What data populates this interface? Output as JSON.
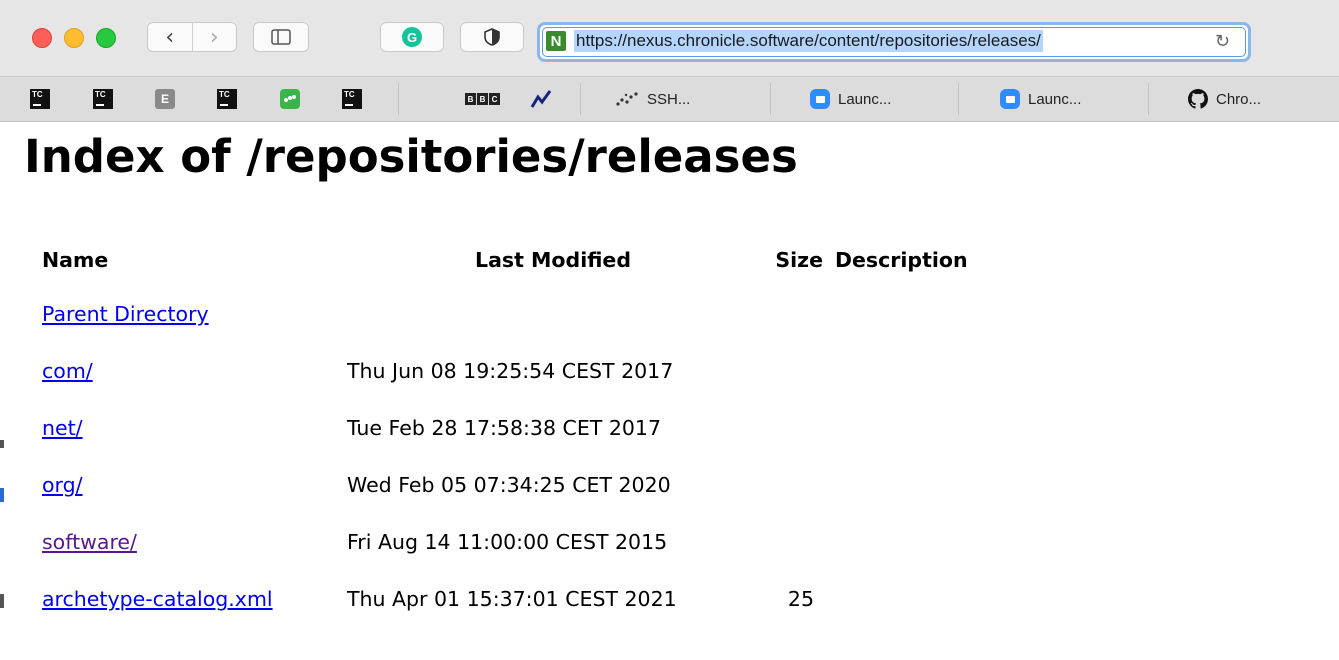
{
  "browser": {
    "url": "https://nexus.chronicle.software/content/repositories/releases/",
    "favicon_letter": "N",
    "nav_back_glyph": "‹",
    "nav_forward_glyph": "›",
    "grammarly_letter": "G"
  },
  "bookmarks": [
    {
      "icon": "tc-icon",
      "glyph": "TC",
      "label": ""
    },
    {
      "icon": "tc-icon",
      "glyph": "TC",
      "label": ""
    },
    {
      "icon": "e-icon",
      "glyph": "E",
      "label": ""
    },
    {
      "icon": "tc-icon",
      "glyph": "TC",
      "label": ""
    },
    {
      "icon": "green-app-icon",
      "glyph": "",
      "label": ""
    },
    {
      "icon": "tc-icon",
      "glyph": "TC",
      "label": ""
    },
    {
      "icon": "bbc-icon",
      "glyph": "BBC",
      "label": ""
    },
    {
      "icon": "chart-icon",
      "glyph": "",
      "label": ""
    },
    {
      "icon": "dots-icon",
      "glyph": "",
      "label": "SSH..."
    },
    {
      "icon": "zoom-icon",
      "glyph": "",
      "label": "Launc..."
    },
    {
      "icon": "zoom-icon",
      "glyph": "",
      "label": "Launc..."
    },
    {
      "icon": "github-icon",
      "glyph": "",
      "label": "Chro..."
    }
  ],
  "page": {
    "title": "Index of /repositories/releases",
    "columns": {
      "name": "Name",
      "last_modified": "Last Modified",
      "size": "Size",
      "description": "Description"
    },
    "parent_link": "Parent Directory",
    "rows": [
      {
        "name": "com/",
        "modified": "Thu Jun 08 19:25:54 CEST 2017",
        "size": "",
        "visited": false
      },
      {
        "name": "net/",
        "modified": "Tue Feb 28 17:58:38 CET 2017",
        "size": "",
        "visited": false
      },
      {
        "name": "org/",
        "modified": "Wed Feb 05 07:34:25 CET 2020",
        "size": "",
        "visited": false
      },
      {
        "name": "software/",
        "modified": "Fri Aug 14 11:00:00 CEST 2015",
        "size": "",
        "visited": true
      },
      {
        "name": "archetype-catalog.xml",
        "modified": "Thu Apr 01 15:37:01 CEST 2021",
        "size": "25",
        "visited": false
      }
    ]
  },
  "colors": {
    "link": "#0000ee",
    "visited_link": "#551a8b",
    "toolbar": "#e6e6e6",
    "address_focus": "#8ab6ea",
    "url_selection": "#b4d5fe"
  }
}
